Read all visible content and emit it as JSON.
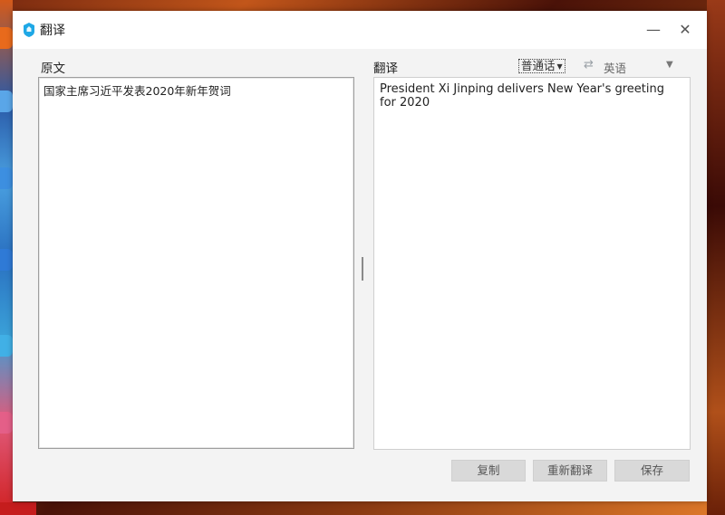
{
  "window": {
    "title": "翻译",
    "minimize_label": "—",
    "close_label": "✕"
  },
  "source": {
    "label": "原文",
    "text": "国家主席习近平发表2020年新年贺词"
  },
  "target": {
    "label": "翻译",
    "text": "President Xi Jinping delivers New Year's greeting for 2020"
  },
  "languages": {
    "from": "普通话",
    "swap_icon": "⇄",
    "to": "英语",
    "dropdown_icon": "▼"
  },
  "buttons": {
    "copy": "复制",
    "retranslate": "重新翻译",
    "save": "保存"
  },
  "colors": {
    "window_bg": "#f3f3f3",
    "titlebar_bg": "#ffffff",
    "button_bg": "#d9d9d9",
    "app_icon": "#1fa8e6"
  }
}
